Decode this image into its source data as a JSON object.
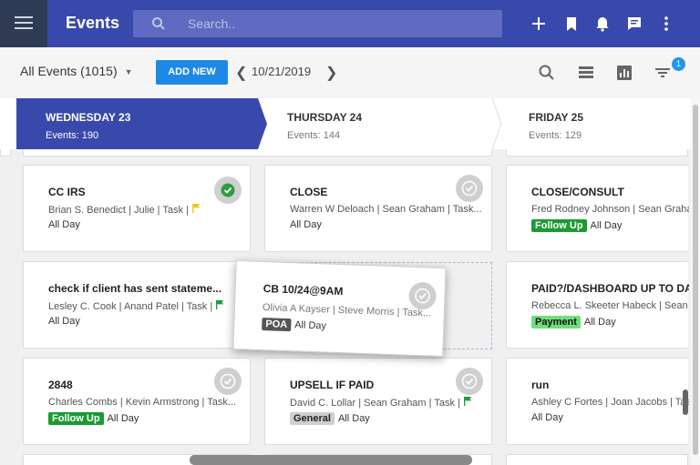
{
  "app": {
    "title": "Events"
  },
  "search": {
    "placeholder": "Search.."
  },
  "toolbar": {
    "filter_label": "All Events (1015)",
    "add_label": "ADD NEW",
    "date": "10/21/2019",
    "filter_badge": "1"
  },
  "days": [
    {
      "name": "WEDNESDAY 23",
      "count": "Events: 190"
    },
    {
      "name": "THURSDAY 24",
      "count": "Events: 144"
    },
    {
      "name": "FRIDAY 25",
      "count": "Events: 129"
    }
  ],
  "cards": {
    "wed": [
      {
        "title": "CC IRS",
        "meta": "Brian S. Benedict | Julie | Task |",
        "allday": "All Day"
      },
      {
        "title": "check if client has sent stateme...",
        "meta": "Lesley C. Cook | Anand Patel | Task |",
        "allday": "All Day"
      },
      {
        "title": "2848",
        "meta": "Charles Combs | Kevin Armstrong | Task...",
        "tag": "Follow Up",
        "allday": "All Day"
      }
    ],
    "thu": [
      {
        "title": "CLOSE",
        "meta": "Warren W Deloach | Sean Graham | Task...",
        "allday": "All Day"
      },
      {
        "title": "UPSELL IF PAID",
        "meta": "David C. Lollar | Sean Graham | Task |",
        "tag": "General",
        "allday": "All Day"
      }
    ],
    "fri": [
      {
        "title": "CLOSE/CONSULT",
        "meta": "Fred Rodney Johnson | Sean Graham",
        "tag": "Follow Up",
        "allday": "All Day"
      },
      {
        "title": "PAID?/DASHBOARD UP TO DAT...",
        "meta": "Rebecca L. Skeeter Habeck | Sean Gra",
        "tag": "Payment",
        "allday": "All Day"
      },
      {
        "title": "run",
        "meta": "Ashley C Fortes | Joan Jacobs | Task",
        "allday": "All Day"
      }
    ],
    "dragging": {
      "title": "CB 10/24@9AM",
      "meta": "Olivia A Kayser | Steve Morris | Task...",
      "tag": "POA",
      "allday": "All Day"
    }
  },
  "colors": {
    "primary": "#3949ab",
    "accent": "#1e88e5",
    "followup": "#1a9b33",
    "payment": "#6ee07a",
    "flag_yellow": "#f5c518",
    "flag_green": "#1a9b33"
  },
  "icons": [
    "menu-icon",
    "search-icon",
    "plus-icon",
    "bookmark-icon",
    "bell-icon",
    "chat-icon",
    "more-vert-icon",
    "list-icon",
    "chart-icon",
    "filter-icon",
    "check-icon",
    "flag-icon"
  ]
}
